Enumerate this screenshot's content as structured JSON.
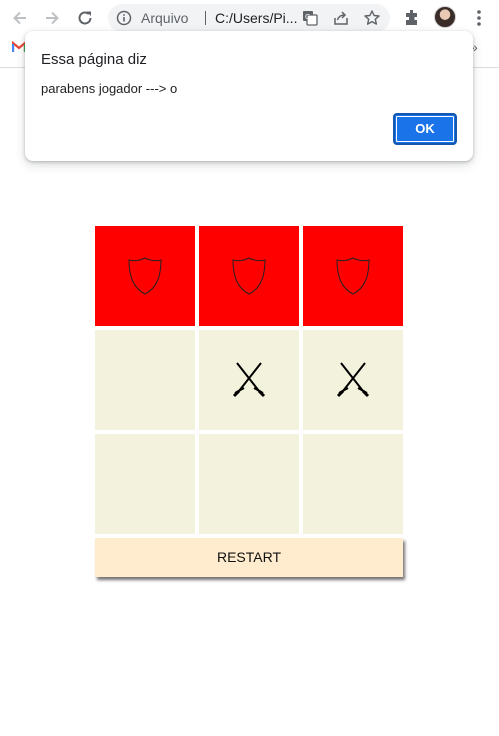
{
  "browser": {
    "omnibox": {
      "security_label": "Arquivo",
      "url_text": "C:/Users/Pi..."
    },
    "bookmarks_overflow": "»"
  },
  "dialog": {
    "title": "Essa página diz",
    "message": "parabens jogador ---> o",
    "ok_label": "OK"
  },
  "board": {
    "cells": [
      {
        "mark": "shield",
        "state": "win"
      },
      {
        "mark": "shield",
        "state": "win"
      },
      {
        "mark": "shield",
        "state": "win"
      },
      {
        "mark": "",
        "state": "empty"
      },
      {
        "mark": "swords",
        "state": "empty"
      },
      {
        "mark": "swords",
        "state": "empty"
      },
      {
        "mark": "",
        "state": "empty"
      },
      {
        "mark": "",
        "state": "empty"
      },
      {
        "mark": "",
        "state": "empty"
      }
    ],
    "win_color": "#ff0000",
    "empty_color": "#f3f3dd"
  },
  "restart_label": "RESTART",
  "colors": {
    "accent": "#1a73e8",
    "restart_bg": "#ffebcd"
  }
}
